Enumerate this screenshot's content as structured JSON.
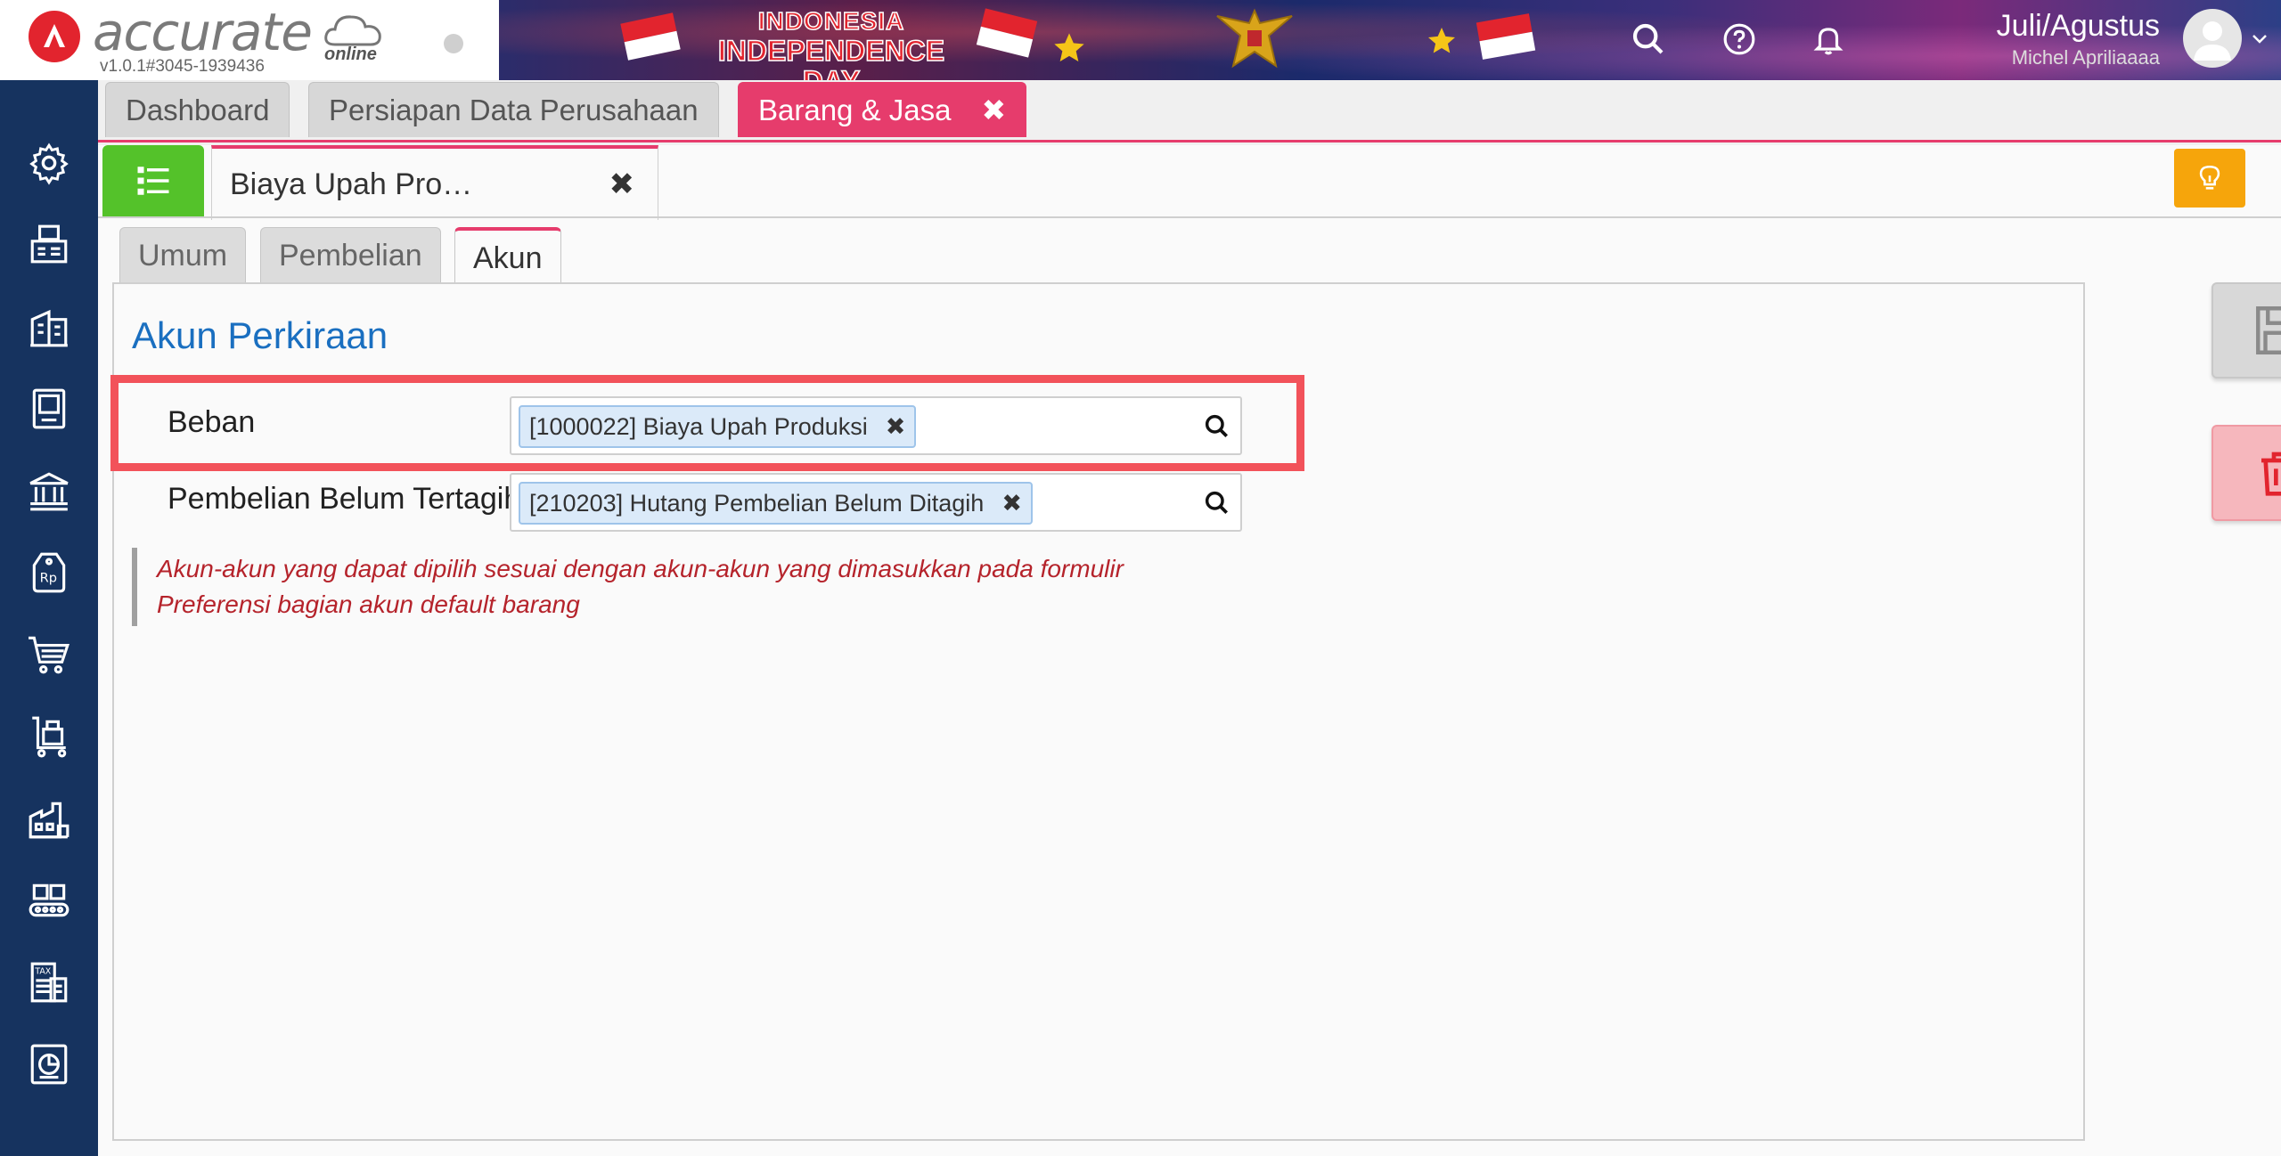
{
  "app": {
    "logo_text": "accurate",
    "logo_sub": "online",
    "version": "v1.0.1#3045-1939436"
  },
  "banner": {
    "line1": "INDONESIA",
    "line2": "INDEPENDENCE DAY"
  },
  "header": {
    "period": "Juli/Agustus",
    "user": "Michel Apriliaaaa",
    "icons": [
      "search-icon",
      "help-icon",
      "bell-icon"
    ]
  },
  "sidebar": {
    "icons": [
      "gear-icon",
      "fax-icon",
      "building-icon",
      "ledger-book-icon",
      "bank-icon",
      "price-tag-icon",
      "shopping-cart-icon",
      "trolley-icon",
      "factory-icon",
      "conveyor-icon",
      "tax-report-icon",
      "dashboard-report-icon"
    ]
  },
  "top_tabs": {
    "tabs": [
      {
        "label": "Dashboard"
      },
      {
        "label": "Persiapan Data Perusahaan"
      },
      {
        "label": "Barang & Jasa"
      }
    ],
    "close_glyph": "✖",
    "count": "3"
  },
  "document": {
    "tab_label": "Biaya Upah Pro…",
    "close_glyph": "✖"
  },
  "inner_tabs": [
    {
      "label": "Umum"
    },
    {
      "label": "Pembelian"
    },
    {
      "label": "Akun"
    }
  ],
  "panel": {
    "title": "Akun Perkiraan",
    "fields": [
      {
        "label": "Beban",
        "value": "[1000022] Biaya Upah Produksi"
      },
      {
        "label": "Pembelian Belum Tertagih",
        "value": "[210203] Hutang Pembelian Belum Ditagih"
      }
    ],
    "chip_remove": "✖",
    "note": "Akun-akun yang dapat dipilih sesuai dengan akun-akun yang dimasukkan pada formulir Preferensi bagian akun default barang"
  },
  "colors": {
    "sidebar": "#16335f",
    "accent": "#e63c6c",
    "title_blue": "#1a6fc0",
    "highlight": "#f2525a",
    "note_red": "#b5232b",
    "list_green": "#54c22a",
    "bulb_orange": "#f6a50b"
  }
}
